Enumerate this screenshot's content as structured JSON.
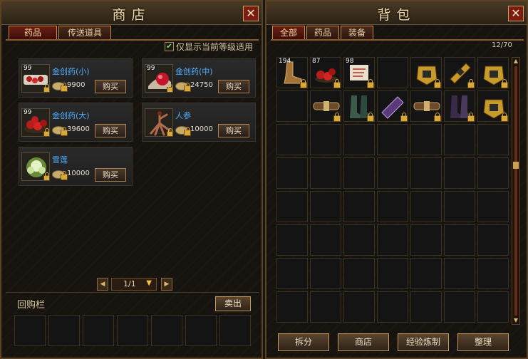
{
  "shop": {
    "title": "商店",
    "close_label": "✕",
    "tabs": [
      {
        "label": "药品"
      },
      {
        "label": "传送道具"
      }
    ],
    "filter_label": "仅显示当前等级适用",
    "items": [
      {
        "qty": "99",
        "name": "金创药(小)",
        "price": "9900",
        "buy_label": "购买",
        "icon": "small-red-pills-icon"
      },
      {
        "qty": "99",
        "name": "金创药(中)",
        "price": "24750",
        "buy_label": "购买",
        "icon": "red-orb-potion-icon"
      },
      {
        "qty": "99",
        "name": "金创药(大)",
        "price": "39600",
        "buy_label": "购买",
        "icon": "large-red-pills-icon"
      },
      {
        "qty": "",
        "name": "人参",
        "price": "10000",
        "buy_label": "购买",
        "icon": "ginseng-root-icon"
      },
      {
        "qty": "",
        "name": "雪莲",
        "price": "10000",
        "buy_label": "购买",
        "icon": "snow-lotus-icon"
      }
    ],
    "page_text": "1/1",
    "buyback_label": "回购栏",
    "sell_label": "卖出"
  },
  "bag": {
    "title": "背包",
    "close_label": "✕",
    "tabs": [
      {
        "label": "全部"
      },
      {
        "label": "药品"
      },
      {
        "label": "装备"
      }
    ],
    "capacity": "12/70",
    "items_row1": [
      {
        "qty": "194",
        "icon": "boots-icon"
      },
      {
        "qty": "87",
        "icon": "red-pills-icon"
      },
      {
        "qty": "98",
        "icon": "scroll-icon"
      },
      {
        "qty": "",
        "icon": "empty-slot"
      },
      {
        "qty": "",
        "icon": "gold-armor-icon"
      },
      {
        "qty": "",
        "icon": "gold-bracer-icon"
      },
      {
        "qty": "",
        "icon": "gold-armor-icon"
      }
    ],
    "items_row2": [
      {
        "qty": "",
        "icon": "empty-slot"
      },
      {
        "qty": "",
        "icon": "belt-icon"
      },
      {
        "qty": "",
        "icon": "green-boots-icon"
      },
      {
        "qty": "",
        "icon": "purple-bracer-icon"
      },
      {
        "qty": "",
        "icon": "belt-icon"
      },
      {
        "qty": "",
        "icon": "purple-boots-icon"
      },
      {
        "qty": "",
        "icon": "gold-armor-icon"
      }
    ],
    "buttons": [
      {
        "label": "拆分"
      },
      {
        "label": "商店"
      },
      {
        "label": "经验炼制"
      },
      {
        "label": "整理"
      }
    ]
  },
  "colors": {
    "item_name": "#4fb0ff",
    "frame_gold": "#c48d4a",
    "tab_red": "#6b1e14"
  }
}
